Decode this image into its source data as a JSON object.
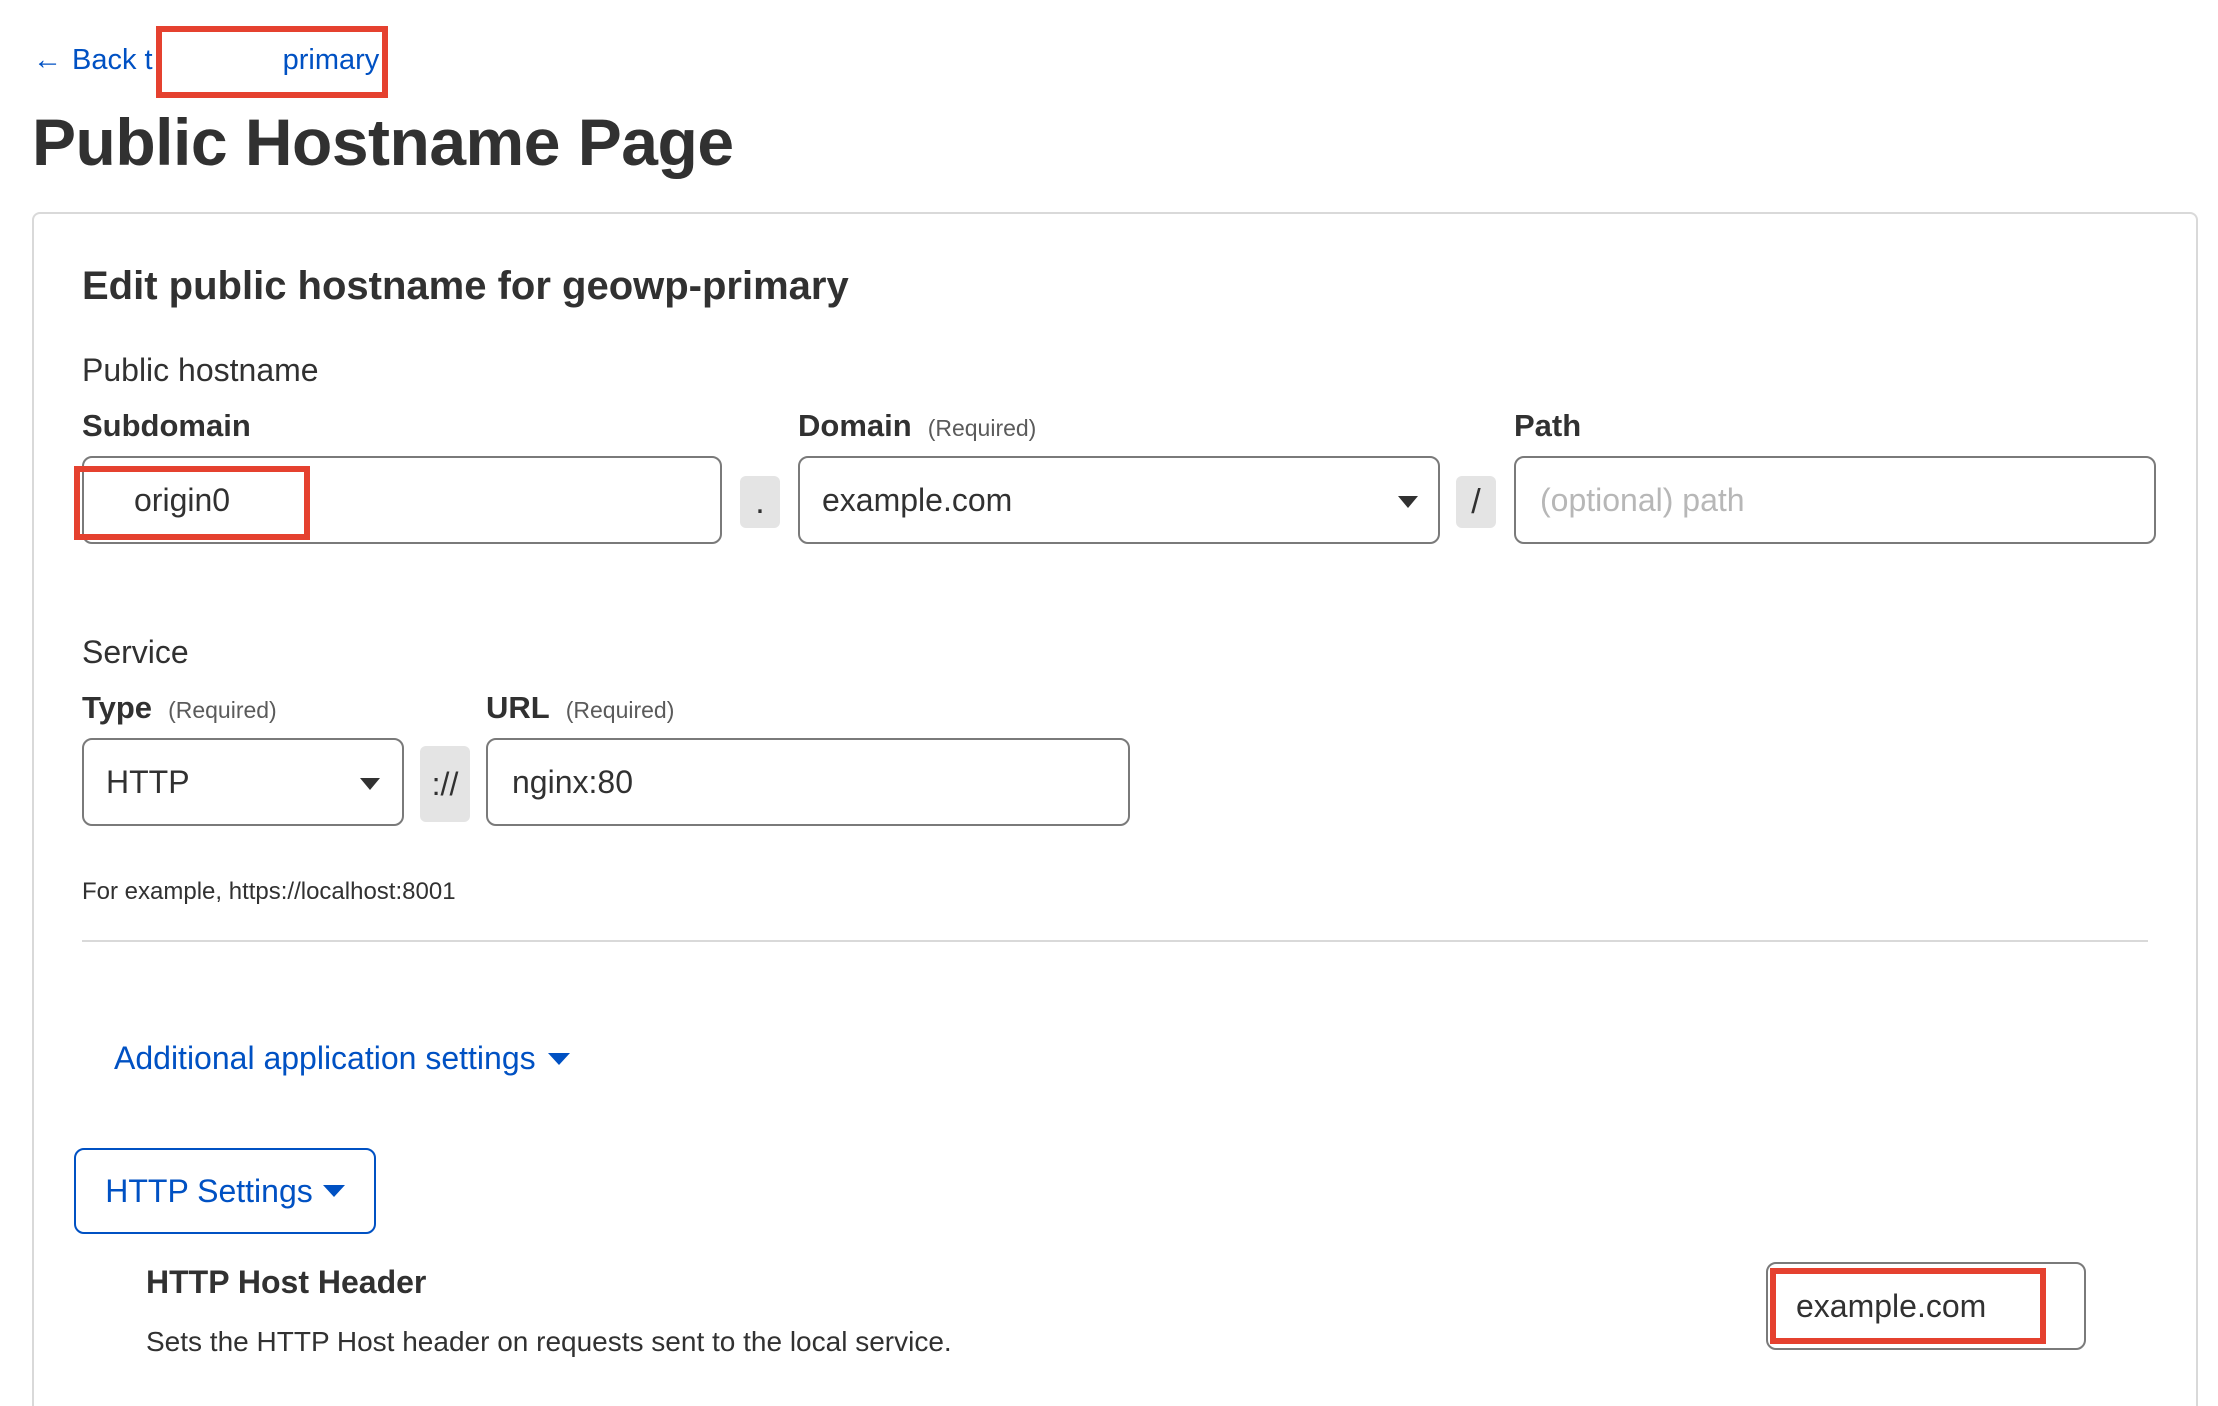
{
  "back_link": {
    "arrow": "←",
    "prefix": "Back t",
    "suffix": "primary"
  },
  "page_title": "Public Hostname Page",
  "card_title": "Edit public hostname for geowp-primary",
  "public_hostname": {
    "section_label": "Public hostname",
    "subdomain": {
      "label": "Subdomain",
      "value": "origin0"
    },
    "dot_separator": ".",
    "domain": {
      "label": "Domain",
      "required": "(Required)",
      "value": "example.com"
    },
    "slash_separator": "/",
    "path": {
      "label": "Path",
      "placeholder": "(optional) path"
    }
  },
  "service": {
    "section_label": "Service",
    "type": {
      "label": "Type",
      "required": "(Required)",
      "value": "HTTP"
    },
    "scheme_separator": "://",
    "url": {
      "label": "URL",
      "required": "(Required)",
      "value": "nginx:80"
    },
    "help": "For example, https://localhost:8001"
  },
  "additional_settings_label": "Additional application settings",
  "http_settings_label": "HTTP Settings",
  "http_host_header": {
    "title": "HTTP Host Header",
    "description": "Sets the HTTP Host header on requests sent to the local service.",
    "value": "example.com"
  },
  "colors": {
    "link": "#0051c3",
    "redaction": "#e5412f",
    "text": "#313131"
  }
}
